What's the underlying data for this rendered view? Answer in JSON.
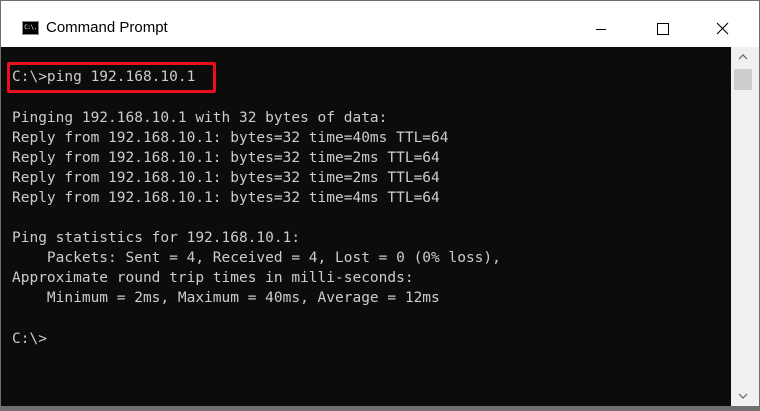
{
  "window": {
    "title": "Command Prompt",
    "icon": "cmd-icon",
    "icon_text": "C:\\."
  },
  "controls": {
    "minimize": "minimize-icon",
    "maximize": "maximize-icon",
    "close": "close-icon"
  },
  "console": {
    "lines": [
      "C:\\>ping 192.168.10.1",
      "",
      "Pinging 192.168.10.1 with 32 bytes of data:",
      "Reply from 192.168.10.1: bytes=32 time=40ms TTL=64",
      "Reply from 192.168.10.1: bytes=32 time=2ms TTL=64",
      "Reply from 192.168.10.1: bytes=32 time=2ms TTL=64",
      "Reply from 192.168.10.1: bytes=32 time=4ms TTL=64",
      "",
      "Ping statistics for 192.168.10.1:",
      "    Packets: Sent = 4, Received = 4, Lost = 0 (0% loss),",
      "Approximate round trip times in milli-seconds:",
      "    Minimum = 2ms, Maximum = 40ms, Average = 12ms",
      "",
      "C:\\>"
    ]
  },
  "colors": {
    "console_background": "#0c0c0c",
    "console_text": "#cccccc",
    "highlight_border": "#e8101c",
    "titlebar_background": "#ffffff"
  }
}
